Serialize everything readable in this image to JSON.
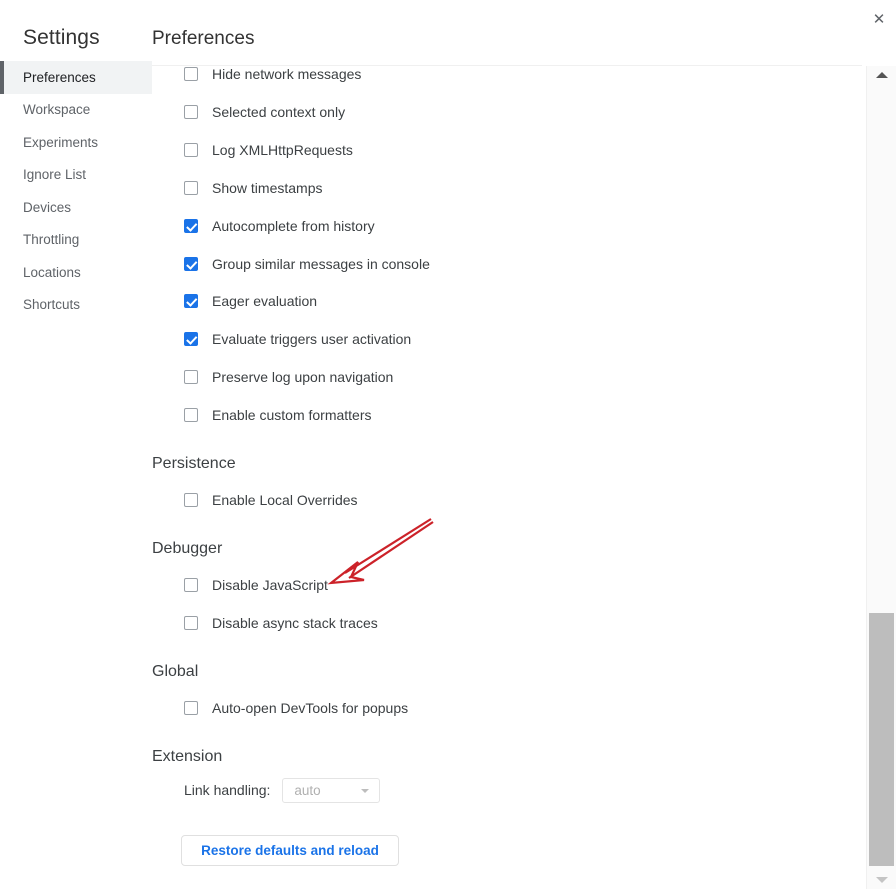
{
  "window": {
    "close_icon": "close-icon",
    "close_label": "✕"
  },
  "sidebar": {
    "title": "Settings",
    "items": [
      {
        "label": "Preferences",
        "selected": true
      },
      {
        "label": "Workspace",
        "selected": false
      },
      {
        "label": "Experiments",
        "selected": false
      },
      {
        "label": "Ignore List",
        "selected": false
      },
      {
        "label": "Devices",
        "selected": false
      },
      {
        "label": "Throttling",
        "selected": false
      },
      {
        "label": "Locations",
        "selected": false
      },
      {
        "label": "Shortcuts",
        "selected": false
      }
    ]
  },
  "main": {
    "title": "Preferences",
    "console_options": [
      {
        "label": "Hide network messages",
        "checked": false
      },
      {
        "label": "Selected context only",
        "checked": false
      },
      {
        "label": "Log XMLHttpRequests",
        "checked": false
      },
      {
        "label": "Show timestamps",
        "checked": false
      },
      {
        "label": "Autocomplete from history",
        "checked": true
      },
      {
        "label": "Group similar messages in console",
        "checked": true
      },
      {
        "label": "Eager evaluation",
        "checked": true
      },
      {
        "label": "Evaluate triggers user activation",
        "checked": true
      },
      {
        "label": "Preserve log upon navigation",
        "checked": false
      },
      {
        "label": "Enable custom formatters",
        "checked": false
      }
    ],
    "sections": [
      {
        "heading": "Persistence",
        "options": [
          {
            "label": "Enable Local Overrides",
            "checked": false
          }
        ]
      },
      {
        "heading": "Debugger",
        "options": [
          {
            "label": "Disable JavaScript",
            "checked": false
          },
          {
            "label": "Disable async stack traces",
            "checked": false
          }
        ]
      },
      {
        "heading": "Global",
        "options": [
          {
            "label": "Auto-open DevTools for popups",
            "checked": false
          }
        ]
      }
    ],
    "extension": {
      "heading": "Extension",
      "link_handling_label": "Link handling:",
      "link_handling_value": "auto",
      "link_handling_options": [
        "auto"
      ]
    },
    "restore_button_label": "Restore defaults and reload"
  },
  "scrollbar": {
    "up_icon": "triangle-up-icon",
    "down_icon": "triangle-down-icon"
  },
  "annotation": {
    "arrow_color": "#cc2229",
    "points_at": "Disable JavaScript"
  },
  "colors": {
    "accent": "#1a73e8",
    "selected_bg": "#f1f3f4",
    "text": "#3c4043",
    "muted_text": "#5f6368",
    "annotation_red": "#cc2229"
  }
}
